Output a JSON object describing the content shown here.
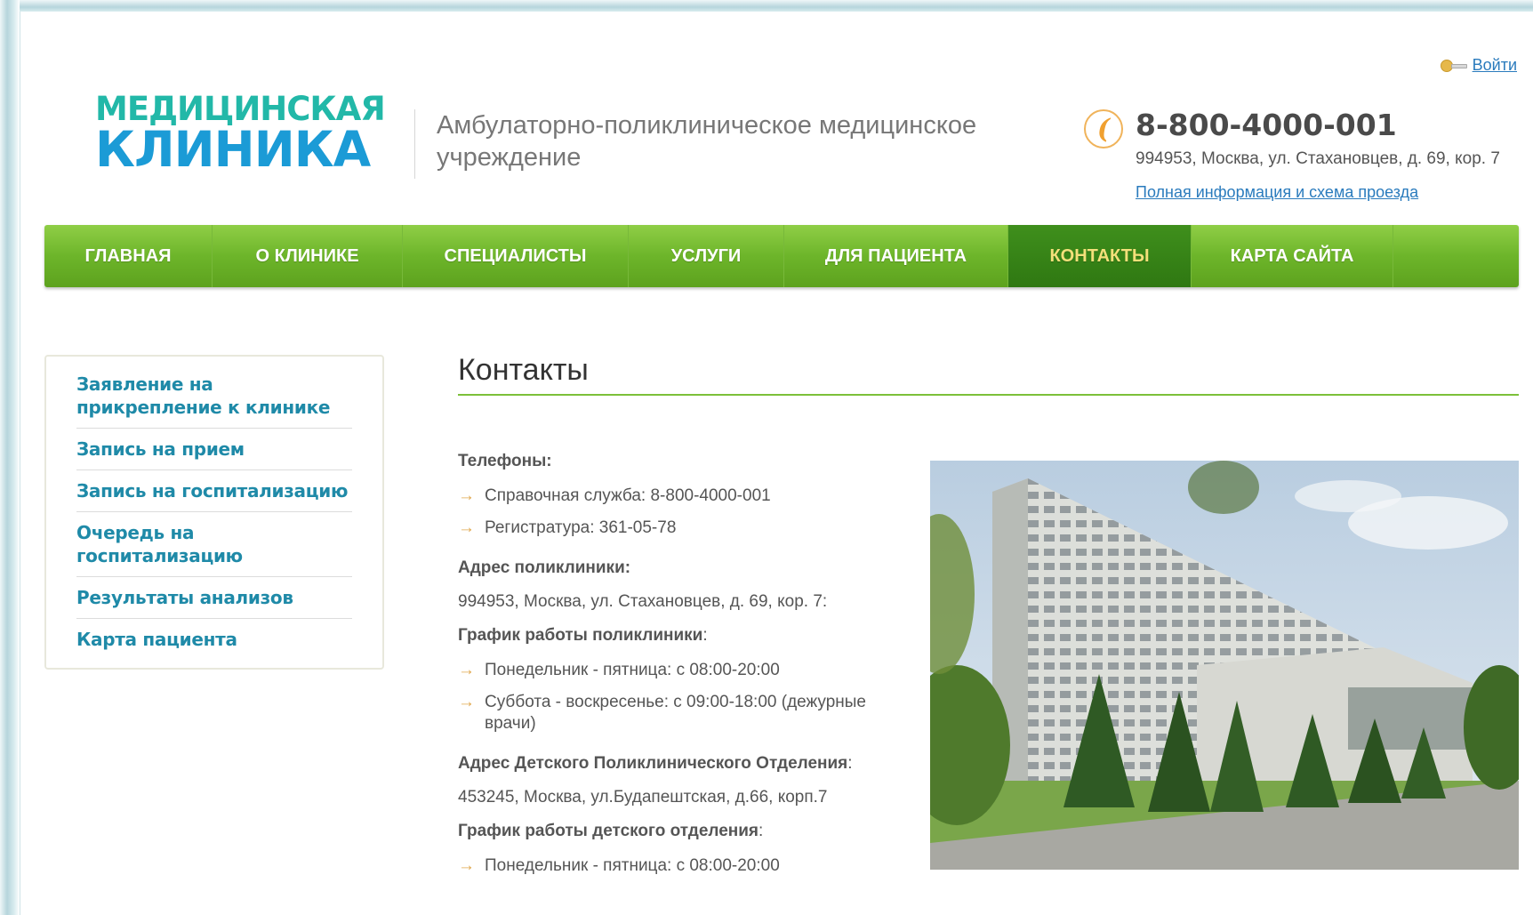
{
  "header": {
    "login_label": "Войти",
    "logo_line1": "МЕДИЦИНСКАЯ",
    "logo_line2": "КЛИНИКА",
    "tagline": "Амбулаторно-поликлиническое медицинское учреждение",
    "phone": "8-800-4000-001",
    "address": "994953, Москва, ул. Стахановцев, д. 69, кор. 7",
    "full_info_link": "Полная информация и схема проезда"
  },
  "nav": {
    "items": [
      {
        "label": "ГЛАВНАЯ"
      },
      {
        "label": "О КЛИНИКЕ"
      },
      {
        "label": "СПЕЦИАЛИСТЫ"
      },
      {
        "label": "УСЛУГИ"
      },
      {
        "label": "ДЛЯ ПАЦИЕНТА"
      },
      {
        "label": "КОНТАКТЫ"
      },
      {
        "label": "КАРТА САЙТА"
      }
    ],
    "active": "КОНТАКТЫ"
  },
  "sidebar": {
    "items": [
      {
        "label": "Заявление на прикрепление к клинике"
      },
      {
        "label": "Запись на прием"
      },
      {
        "label": "Запись на госпитализацию"
      },
      {
        "label": "Очередь на госпитализацию"
      },
      {
        "label": "Результаты анализов"
      },
      {
        "label": "Карта пациента"
      }
    ]
  },
  "main": {
    "title": "Контакты",
    "phones_heading": "Телефоны:",
    "phones": [
      "Справочная служба: 8-800-4000-001",
      "Регистратура: 361-05-78"
    ],
    "clinic_address_heading": "Адрес поликлиники:",
    "clinic_address": "994953, Москва, ул. Стахановцев, д. 69, кор. 7:",
    "clinic_schedule_heading": "График работы поликлиники",
    "clinic_schedule": [
      "Понедельник - пятница: с 08:00-20:00",
      "Суббота - воскресенье: с 09:00-18:00 (дежурные врачи)"
    ],
    "children_address_heading": "Адрес Детского Поликлинического Отделения",
    "children_address": "453245, Москва, ул.Будапештская, д.66, корп.7",
    "children_schedule_heading": "График работы детского отделения",
    "children_schedule": [
      "Понедельник - пятница: с 08:00-20:00"
    ],
    "heading_suffix": ":"
  },
  "colors": {
    "nav_green": "#6db52a",
    "nav_active": "#2f7812",
    "nav_active_text": "#f3e07a",
    "link_blue": "#2a7bbd",
    "sidebar_link": "#1f8aa8",
    "logo_teal": "#22b8a8",
    "logo_blue": "#1b9bd6",
    "accent_rule": "#7cc03a",
    "bullet_arrow": "#e0a84e"
  },
  "icons": {
    "login": "key-icon",
    "phone": "phone-icon",
    "bullet": "arrow-right-icon"
  }
}
